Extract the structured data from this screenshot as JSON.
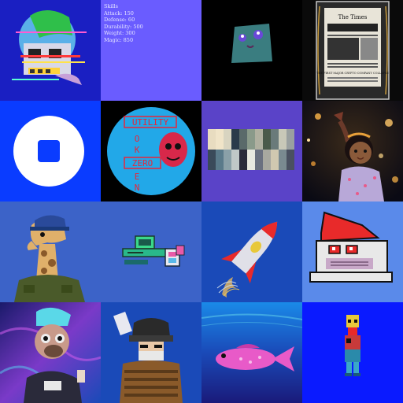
{
  "skills": {
    "title": "Skills",
    "lines": [
      "Attack: 150",
      "Defense: 60",
      "Durability: 500",
      "Weight: 300",
      "Magic: 850"
    ]
  },
  "newspaper": {
    "masthead": "The Times",
    "headline": "THE FIRST MAJOR CRYPTO COMPANY COLLAPSE"
  },
  "utility_token": {
    "word_utility": "UTILITY",
    "word_zero": "ZERO",
    "column_letters": [
      "O",
      "K",
      "E",
      "N"
    ]
  },
  "colors": {
    "page_bg": "#1b1f6b",
    "skills_bg": "#6a5cff",
    "blue_bright": "#0a3cff",
    "blue_mid": "#3c63c8",
    "purple": "#5a43c8"
  },
  "tiles": [
    {
      "name": "nft-tile-glitch-skull",
      "icon": "glitch-skull-art"
    },
    {
      "name": "nft-tile-skills-card",
      "icon": "text-card"
    },
    {
      "name": "nft-tile-square-face",
      "icon": "square-face-art"
    },
    {
      "name": "nft-tile-framed-newspaper",
      "icon": "framed-newspaper-art"
    },
    {
      "name": "nft-tile-stop-button",
      "icon": "stop-icon"
    },
    {
      "name": "nft-tile-utility-token",
      "icon": "utility-token-art"
    },
    {
      "name": "nft-tile-color-palette",
      "icon": "palette-swatches-art"
    },
    {
      "name": "nft-tile-girl-stars",
      "icon": "girl-illustration-art"
    },
    {
      "name": "nft-tile-giraffe",
      "icon": "giraffe-art"
    },
    {
      "name": "nft-tile-retro-computer",
      "icon": "computer-art"
    },
    {
      "name": "nft-tile-rocket",
      "icon": "rocket-art"
    },
    {
      "name": "nft-tile-pixel-gnome",
      "icon": "pixel-gnome-art"
    },
    {
      "name": "nft-tile-punk-character",
      "icon": "punk-character-art"
    },
    {
      "name": "nft-tile-samurai",
      "icon": "samurai-art"
    },
    {
      "name": "nft-tile-pink-fish",
      "icon": "fish-art"
    },
    {
      "name": "nft-tile-pixel-figure",
      "icon": "pixel-figure-art"
    }
  ]
}
